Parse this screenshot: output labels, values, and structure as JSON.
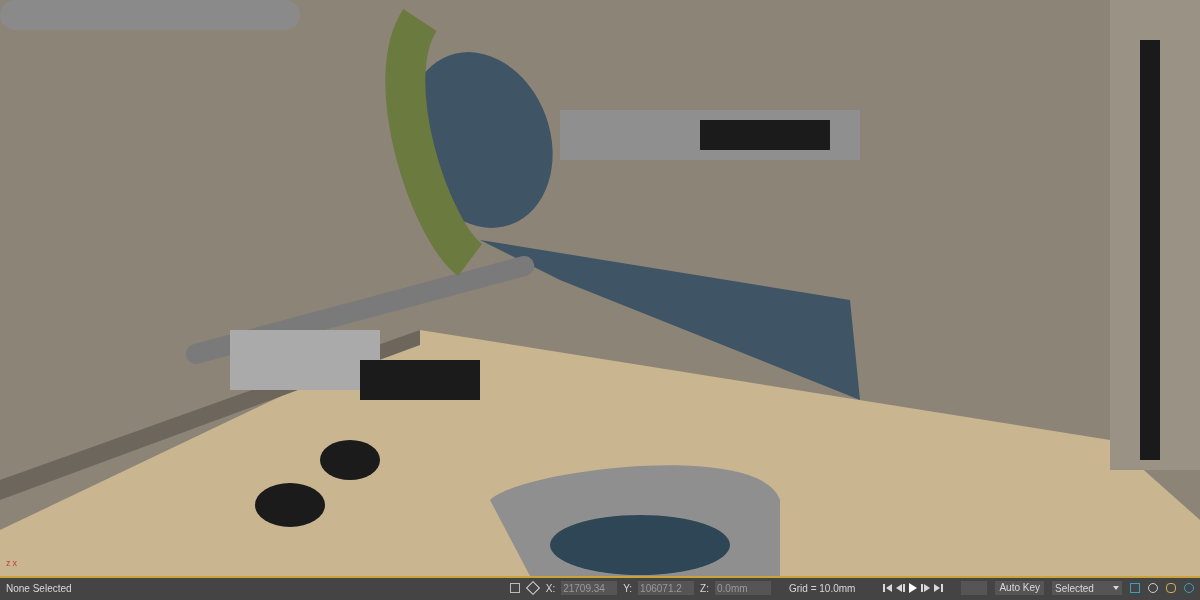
{
  "viewport": {
    "axis_labels": [
      "z",
      "x"
    ]
  },
  "status_bar": {
    "selection": "None Selected",
    "coords": [
      {
        "label": "X:",
        "value": "21709.34"
      },
      {
        "label": "Y:",
        "value": "106071.2"
      },
      {
        "label": "Z:",
        "value": "0.0mm"
      }
    ],
    "grid": "Grid = 10.0mm",
    "auto_key": "Auto Key",
    "key_filter": "Selected"
  }
}
